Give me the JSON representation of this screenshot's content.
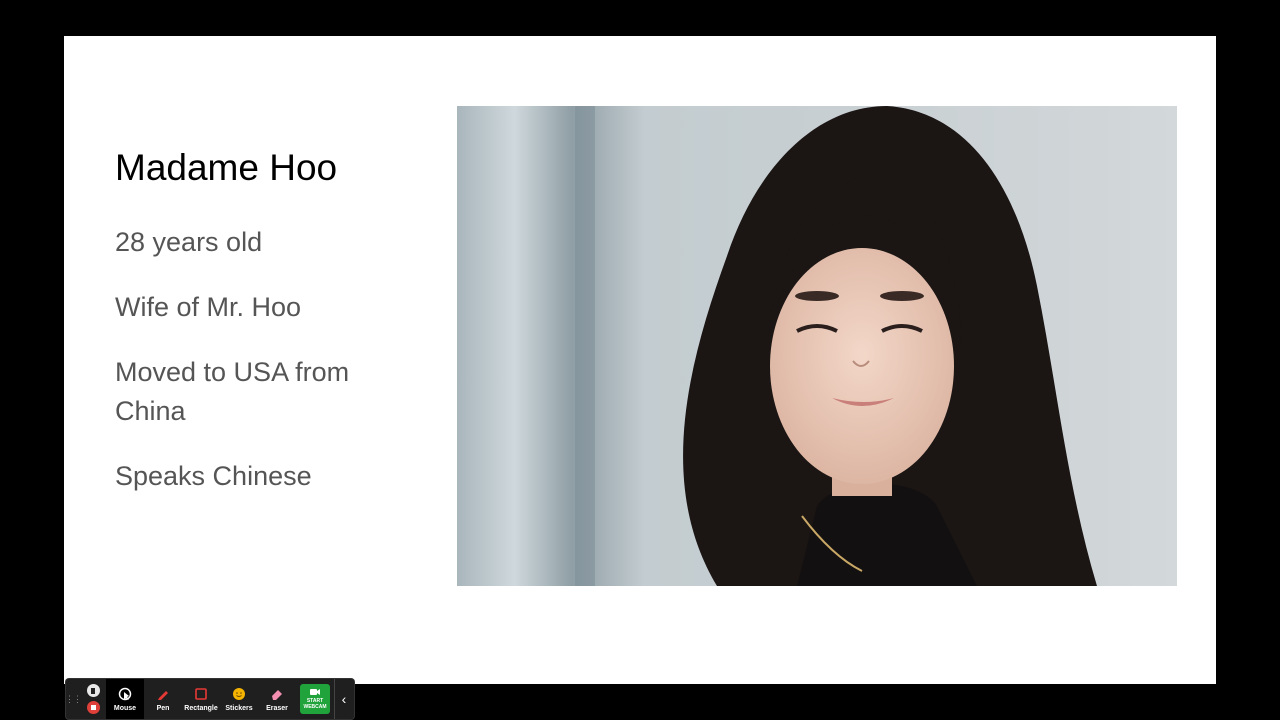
{
  "slide": {
    "title": "Madame Hoo",
    "bullets": [
      "28 years old",
      "Wife of Mr. Hoo",
      "Moved to USA from China",
      "Speaks Chinese"
    ]
  },
  "toolbar": {
    "tools": [
      {
        "label": "Mouse",
        "icon": "mouse-pointer-icon"
      },
      {
        "label": "Pen",
        "icon": "pen-icon"
      },
      {
        "label": "Rectangle",
        "icon": "rectangle-icon"
      },
      {
        "label": "Stickers",
        "icon": "sticker-icon"
      },
      {
        "label": "Eraser",
        "icon": "eraser-icon"
      }
    ],
    "webcam_line1": "START",
    "webcam_line2": "WEBCAM",
    "collapse_glyph": "‹"
  }
}
